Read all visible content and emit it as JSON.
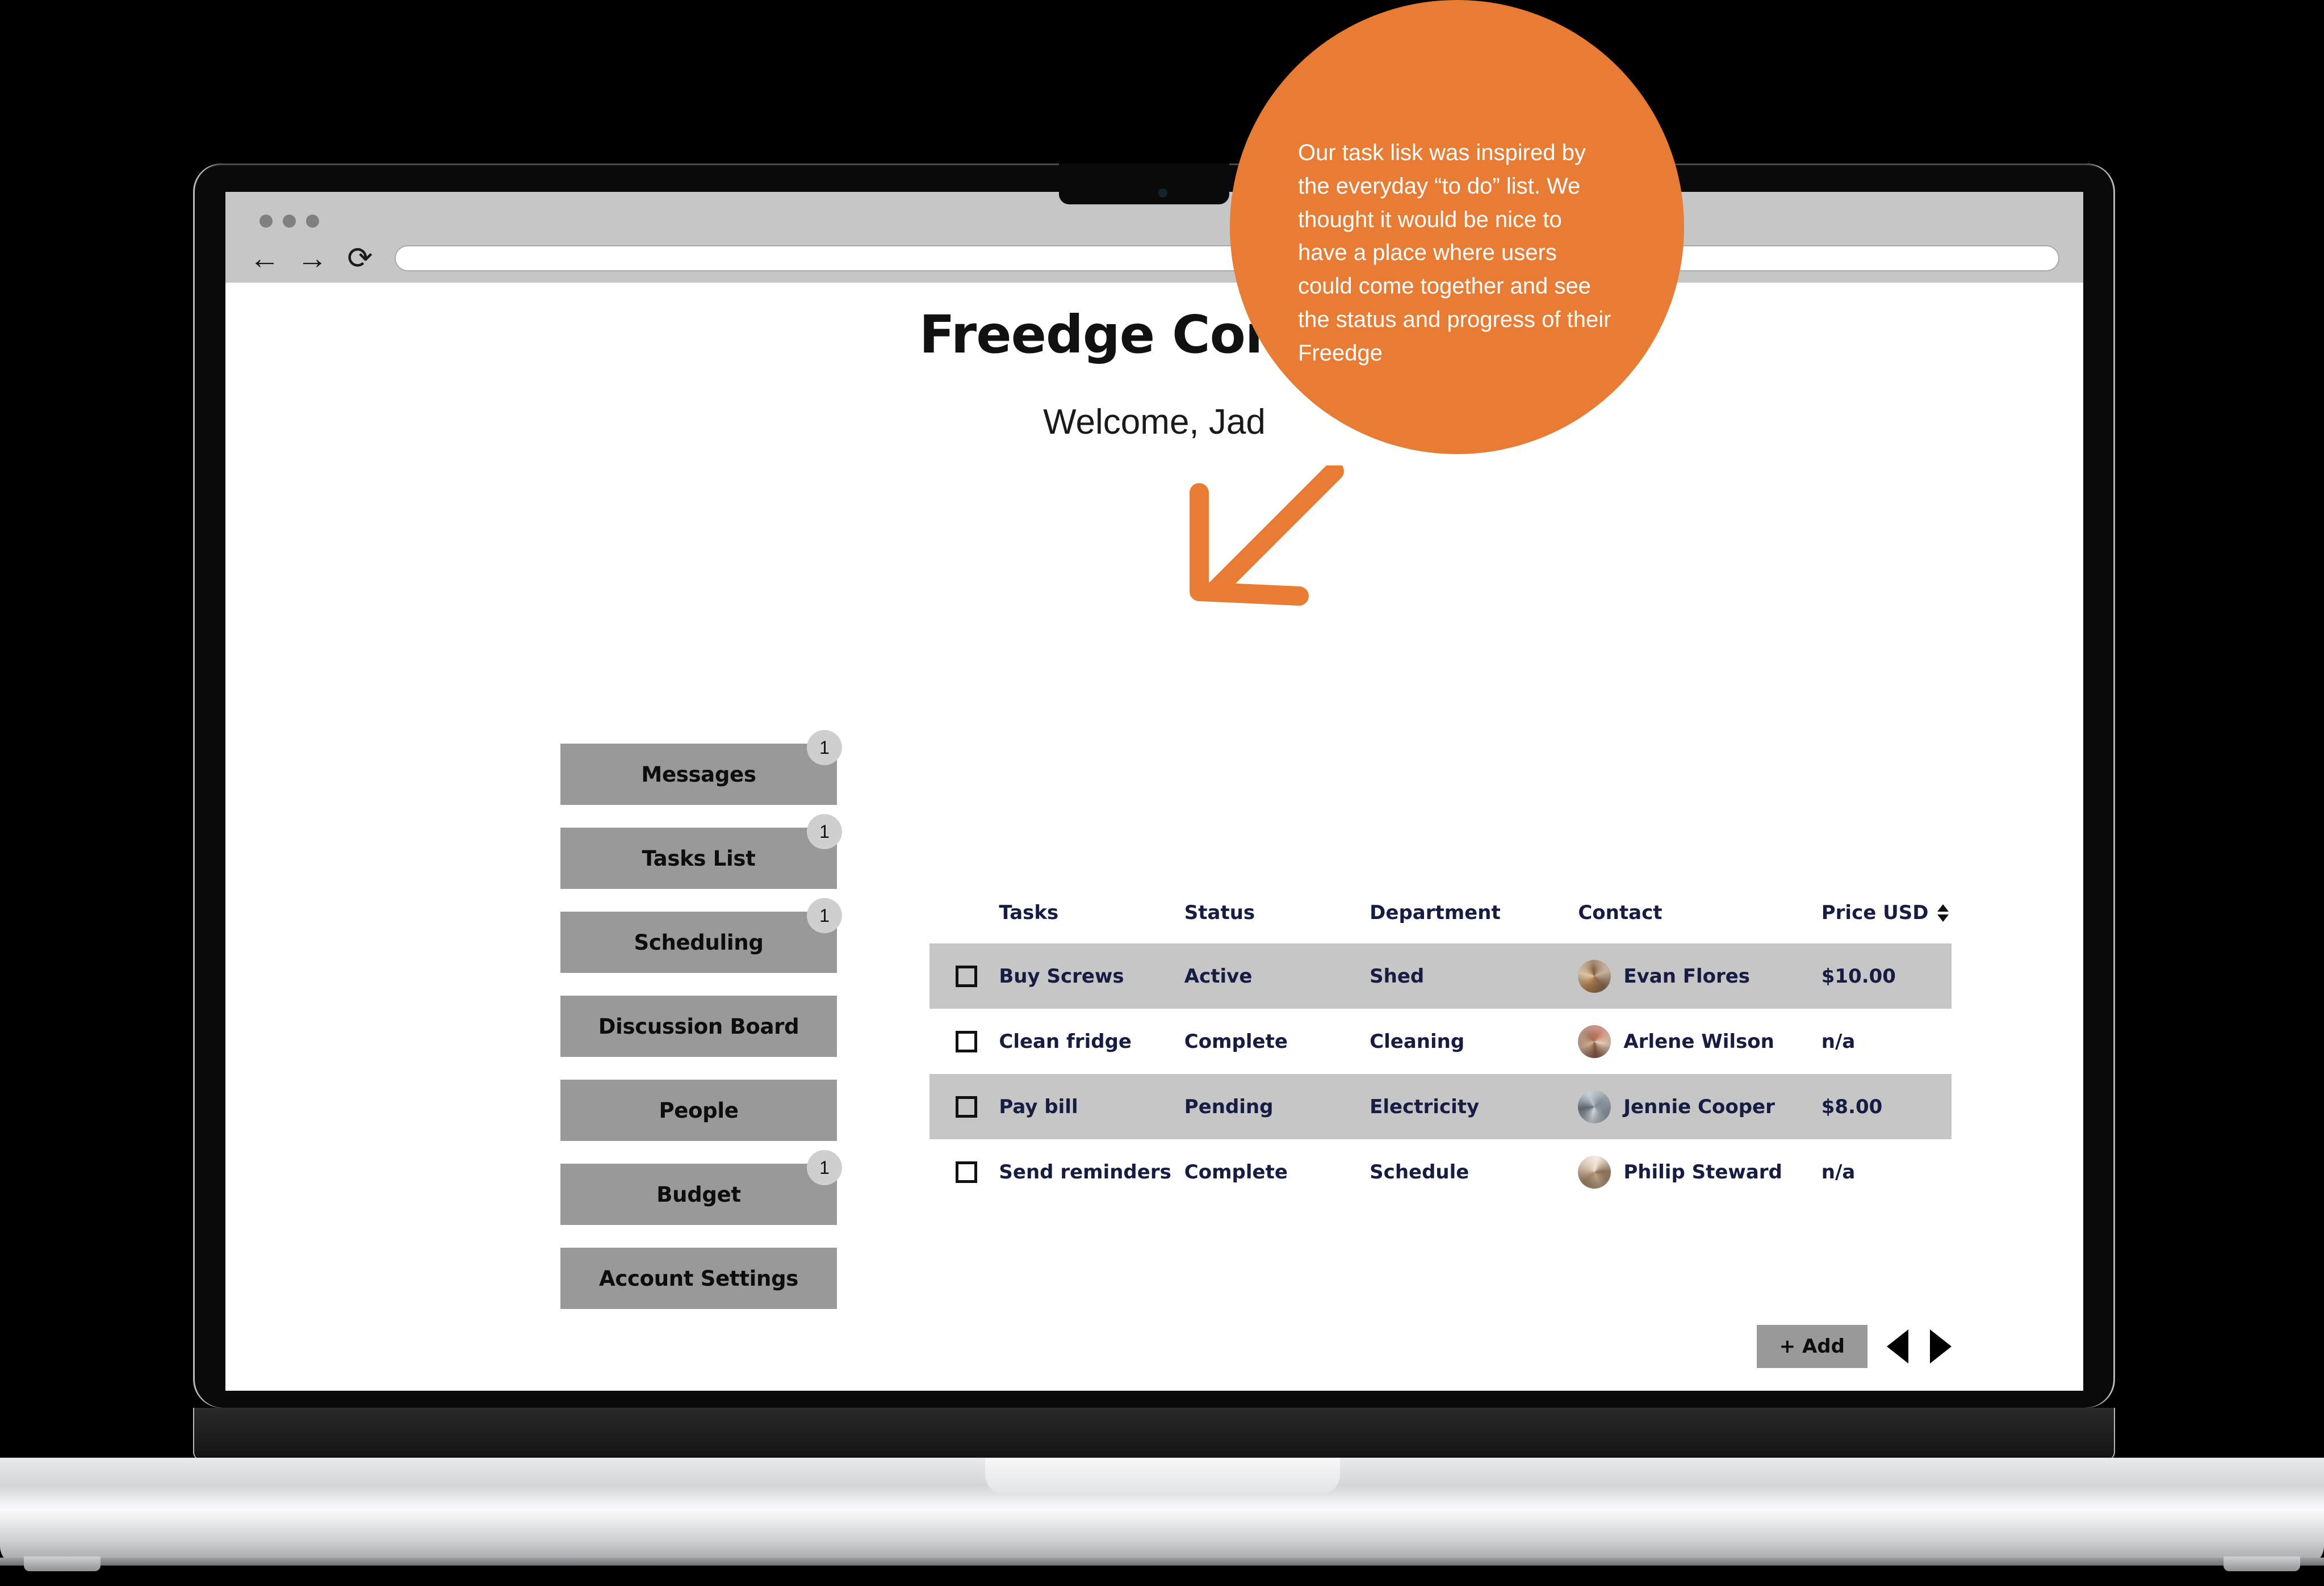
{
  "browser": {
    "window_dots": [
      "dot-1",
      "dot-2",
      "dot-3"
    ],
    "back_icon": "←",
    "forward_icon": "→",
    "reload_icon": "⟳",
    "address_value": "",
    "address_placeholder": ""
  },
  "page": {
    "title": "Freedge Commu",
    "welcome": "Welcome, Jad"
  },
  "sidebar": {
    "items": [
      {
        "label": "Messages",
        "badge": "1"
      },
      {
        "label": "Tasks List",
        "badge": "1"
      },
      {
        "label": "Scheduling",
        "badge": "1"
      },
      {
        "label": "Discussion Board",
        "badge": ""
      },
      {
        "label": "People",
        "badge": ""
      },
      {
        "label": "Budget",
        "badge": "1"
      },
      {
        "label": "Account Settings",
        "badge": ""
      }
    ]
  },
  "table": {
    "columns": [
      "Tasks",
      "Status",
      "Department",
      "Contact",
      "Price USD"
    ],
    "sort_icon": "sort-updown-icon",
    "rows": [
      {
        "task": "Buy Screws",
        "status": "Active",
        "department": "Shed",
        "contact": "Evan Flores",
        "price": "$10.00",
        "checked": false
      },
      {
        "task": "Clean fridge",
        "status": "Complete",
        "department": "Cleaning",
        "contact": "Arlene Wilson",
        "price": "n/a",
        "checked": false
      },
      {
        "task": "Pay bill",
        "status": "Pending",
        "department": "Electricity",
        "contact": "Jennie Cooper",
        "price": "$8.00",
        "checked": false
      },
      {
        "task": "Send reminders",
        "status": "Complete",
        "department": "Schedule",
        "contact": "Philip Steward",
        "price": "n/a",
        "checked": false
      }
    ]
  },
  "footer": {
    "add_label": "+ Add",
    "prev_icon": "triangle-left-icon",
    "next_icon": "triangle-right-icon"
  },
  "callout": {
    "text": "Our task lisk was inspired by the everyday “to do” list. We thought it would be nice to have a place where users could come together and see the status and progress of their Freedge",
    "color": "#E87C35",
    "arrow_icon": "arrow-down-left-icon"
  },
  "colors": {
    "accent_orange": "#E87C35",
    "nav_gray": "#999999",
    "row_gray": "#C6C6C6",
    "chrome_gray": "#C6C6C6",
    "table_text": "#171C42"
  }
}
